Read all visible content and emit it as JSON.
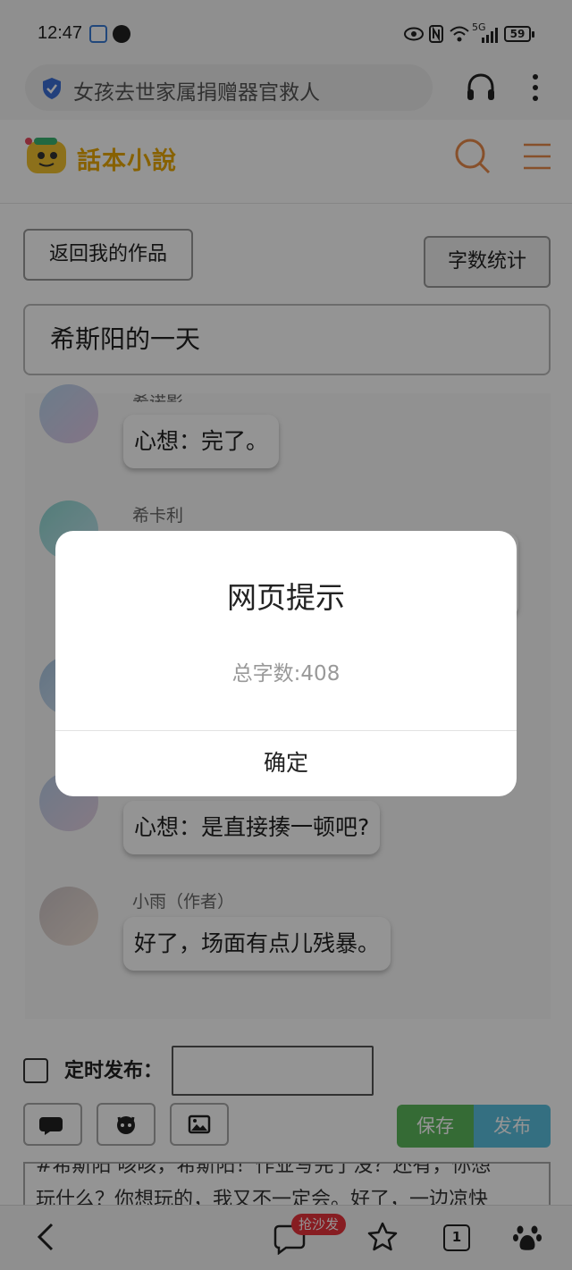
{
  "status_bar": {
    "time": "12:47",
    "battery": "59",
    "network": "5G"
  },
  "browser": {
    "url_text": "女孩去世家属捐赠器官救人"
  },
  "site": {
    "logo_text": "話本小說"
  },
  "editor": {
    "back_button": "返回我的作品",
    "word_count_button": "字数统计",
    "title_value": "希斯阳的一天",
    "messages": [
      {
        "name": "希诺影",
        "text": "心想：完了。"
      },
      {
        "name": "希卡利",
        "text": ""
      },
      {
        "name": "",
        "text": ""
      },
      {
        "name": "",
        "text": "心想：是直接揍一顿吧?"
      },
      {
        "name": "小雨（作者）",
        "text": "好了，场面有点儿残暴。"
      }
    ],
    "schedule_label": "定时发布：",
    "save_button": "保存",
    "publish_button": "发布",
    "body_line1": "#希斯阳 咳咳，希斯阳！作业写完了没？还有，你想",
    "body_line2": "玩什么？你想玩的，我又不一定会。好了，一边凉快"
  },
  "bottom_nav": {
    "sofa_badge": "抢沙发",
    "tab_count": "1"
  },
  "dialog": {
    "title": "网页提示",
    "message": "总字数:408",
    "confirm": "确定"
  },
  "colors": {
    "save": "#5cb85c",
    "publish": "#5bc0de",
    "logo": "#e8a800",
    "accent_orange": "#e88a4a"
  }
}
